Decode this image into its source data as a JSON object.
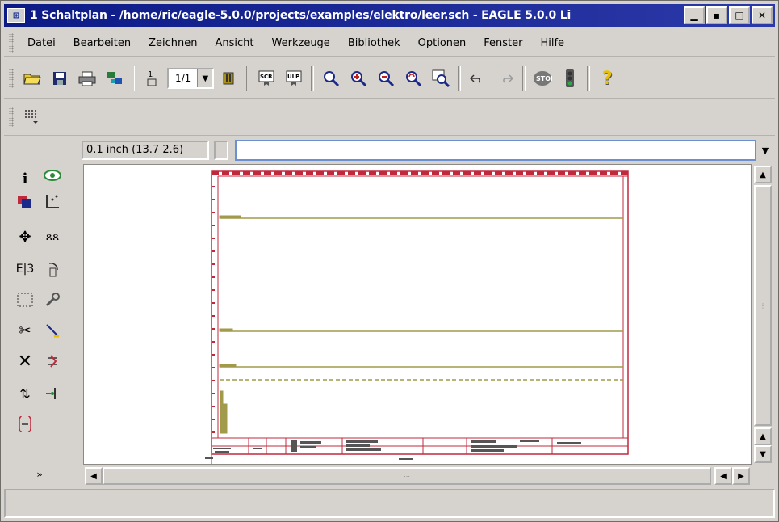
{
  "window": {
    "title": "1 Schaltplan - /home/ric/eagle-5.0.0/projects/examples/elektro/leer.sch - EAGLE 5.0.0 Li",
    "buttons": [
      "minimize",
      "restore",
      "maximize",
      "close"
    ]
  },
  "menubar": {
    "items": [
      "Datei",
      "Bearbeiten",
      "Zeichnen",
      "Ansicht",
      "Werkzeuge",
      "Bibliothek",
      "Optionen",
      "Fenster",
      "Hilfe"
    ]
  },
  "toolbar": {
    "sheet_value": "1/1",
    "icons": [
      "open-folder-icon",
      "save-icon",
      "print-icon",
      "cam-icon",
      "sheet-icon",
      "board-icon",
      "script-icon",
      "ulp-icon",
      "zoom-fit-icon",
      "zoom-in-icon",
      "zoom-out-icon",
      "zoom-redraw-icon",
      "zoom-select-icon",
      "undo-icon",
      "redo-icon",
      "stop-icon",
      "go-icon",
      "help-icon"
    ]
  },
  "commandline": {
    "coordinates": "0.1 inch (13.7 2.6)",
    "value": ""
  },
  "statusbar": {
    "text": ""
  },
  "colors": {
    "titlebar": "#0c1a86",
    "frame": "#c0283c",
    "net": "#a09a4a",
    "input_border": "#6c8fcf"
  }
}
